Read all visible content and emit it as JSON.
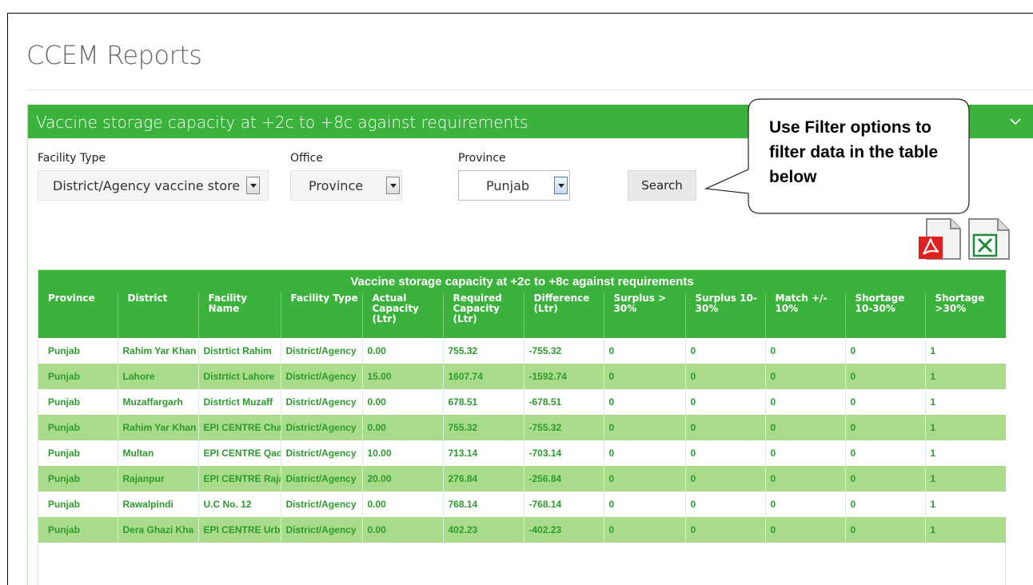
{
  "page": {
    "title": "CCEM Reports"
  },
  "panel": {
    "title": "Vaccine storage capacity at +2c to +8c against requirements"
  },
  "filters": {
    "facility_type": {
      "label": "Facility Type",
      "value": "District/Agency vaccine store"
    },
    "office": {
      "label": "Office",
      "value": "Province"
    },
    "province": {
      "label": "Province",
      "value": "Punjab"
    },
    "search_label": "Search"
  },
  "callout": {
    "text": "Use Filter options to filter data in the table below"
  },
  "exports": {
    "pdf_icon": "pdf-export-icon",
    "excel_icon": "excel-export-icon"
  },
  "colors": {
    "brand_green": "#3bb23b",
    "row_alt": "#a8dc8a",
    "cell_text": "#2e9a2e"
  },
  "table": {
    "caption": "Vaccine storage capacity at +2c to +8c against requirements",
    "columns": [
      "Province",
      "District",
      "Facility Name",
      "Facility Type",
      "Actual Capacity (Ltr)",
      "Required Capacity (Ltr)",
      "Difference (Ltr)",
      "Surplus > 30%",
      "Surplus 10-30%",
      "Match +/- 10%",
      "Shortage 10-30%",
      "Shortage >30%"
    ],
    "rows": [
      [
        "Punjab",
        "Rahim Yar Khan",
        "Distrtict Rahim",
        "District/Agency",
        "0.00",
        "755.32",
        "-755.32",
        "0",
        "0",
        "0",
        "0",
        "1"
      ],
      [
        "Punjab",
        "Lahore",
        "Distrtict Lahore",
        "District/Agency",
        "15.00",
        "1607.74",
        "-1592.74",
        "0",
        "0",
        "0",
        "0",
        "1"
      ],
      [
        "Punjab",
        "Muzaffargarh",
        "Distrtict Muzaff",
        "District/Agency",
        "0.00",
        "678.51",
        "-678.51",
        "0",
        "0",
        "0",
        "0",
        "1"
      ],
      [
        "Punjab",
        "Rahim Yar Khan",
        "EPI CENTRE Cha",
        "District/Agency",
        "0.00",
        "755.32",
        "-755.32",
        "0",
        "0",
        "0",
        "0",
        "1"
      ],
      [
        "Punjab",
        "Multan",
        "EPI CENTRE Qad",
        "District/Agency",
        "10.00",
        "713.14",
        "-703.14",
        "0",
        "0",
        "0",
        "0",
        "1"
      ],
      [
        "Punjab",
        "Rajanpur",
        "EPI CENTRE Raja",
        "District/Agency",
        "20.00",
        "276.84",
        "-256.84",
        "0",
        "0",
        "0",
        "0",
        "1"
      ],
      [
        "Punjab",
        "Rawalpindi",
        "U.C No. 12",
        "District/Agency",
        "0.00",
        "768.14",
        "-768.14",
        "0",
        "0",
        "0",
        "0",
        "1"
      ],
      [
        "Punjab",
        "Dera Ghazi Kha",
        "EPI CENTRE Urb",
        "District/Agency",
        "0.00",
        "402.23",
        "-402.23",
        "0",
        "0",
        "0",
        "0",
        "1"
      ]
    ]
  }
}
